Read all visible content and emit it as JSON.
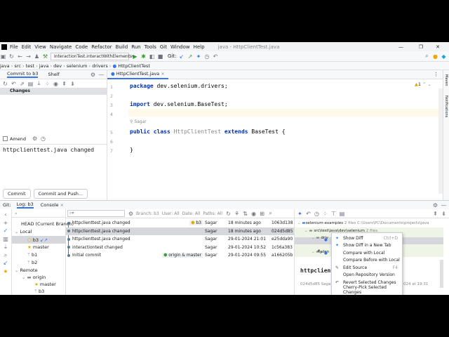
{
  "window": {
    "title": "java - HttpClientTest.java",
    "menu": [
      "File",
      "Edit",
      "View",
      "Navigate",
      "Code",
      "Refactor",
      "Build",
      "Run",
      "Tools",
      "Git",
      "Window",
      "Help"
    ]
  },
  "toolbar": {
    "run_config": "InteractionTest.interactWithElements",
    "git_label": "Git:"
  },
  "breadcrumb": [
    "java",
    "src",
    "test",
    "java",
    "dev",
    "selenium",
    "drivers",
    "HttpClientTest"
  ],
  "commit_panel": {
    "tabs": [
      "Commit to b3",
      "Shelf"
    ],
    "changes_header": "Changes",
    "amend_label": "Amend",
    "message": "httpclienttest.java changed",
    "commit_button": "Commit",
    "commit_push_button": "Commit and Push..."
  },
  "editor": {
    "tab": "HttpClientTest.java",
    "warnings": "1",
    "right_strip": [
      "Maven",
      "Notifications"
    ],
    "lines": [
      {
        "n": "1",
        "t": "package"
      },
      {
        "n": "2"
      },
      {
        "n": "3"
      },
      {
        "n": "4"
      },
      {
        "n": "5"
      },
      {
        "n": "6"
      },
      {
        "n": "7"
      }
    ],
    "code": {
      "l1_kw": "package",
      "l1_rest": " dev.selenium.drivers;",
      "l3_kw": "import",
      "l3_rest": " dev.selenium.BaseTest;",
      "author": "Sagar",
      "l5_kw1": "public class",
      "l5_name": " HttpClientTest ",
      "l5_kw2": "extends",
      "l5_rest": " BaseTest {",
      "l7": "}"
    }
  },
  "git": {
    "tabs": [
      "Git:",
      "Log: b3",
      "Console"
    ],
    "branches": {
      "head": "HEAD (Current Branch)",
      "local": "Local",
      "local_items": [
        "b3",
        "master",
        "b1",
        "b2"
      ],
      "remote": "Remote",
      "origin": "origin",
      "remote_items": [
        "master",
        "b3"
      ]
    },
    "filters": {
      "branch": "Branch: b3",
      "user": "User: All",
      "date": "Date: All",
      "paths": "Paths: All"
    },
    "commits": [
      {
        "msg": "httpclienttest.java changed",
        "tag": "b3",
        "author": "Sagar",
        "date": "18 minutes ago",
        "hash": "1063d138"
      },
      {
        "msg": "httpclienttest.java changed",
        "tag": "",
        "author": "Sagar",
        "date": "18 minutes ago",
        "hash": "024d5d85"
      },
      {
        "msg": "httpclienttest.java changed",
        "tag": "",
        "author": "Sagar",
        "date": "29-01-2024 21:01",
        "hash": "e25dda90"
      },
      {
        "msg": "interactiontest changed",
        "tag": "",
        "author": "Sagar",
        "date": "29-01-2024 10:52",
        "hash": "1c56a383"
      },
      {
        "msg": "Initial commit",
        "tag": "origin & master",
        "author": "Sagar",
        "date": "29-01-2024 09:55",
        "hash": "a166205b"
      }
    ],
    "details": {
      "root": "selenium-examples",
      "root_meta": "2 files  C:\\Users\\PC\\Documents\\projects\\java",
      "src": "src\\test\\java\\dev\\selenium",
      "src_meta": "2 files",
      "drivers": "driv",
      "elements": "elen",
      "commit_title": "httpclient",
      "commit_meta": "024d5d85 Sagar",
      "commit_date": "024 at 19:31"
    }
  },
  "context_menu": [
    {
      "label": "Show Diff",
      "shortcut": "Ctrl+D"
    },
    {
      "label": "Show Diff in a New Tab"
    },
    {
      "label": "Compare with Local"
    },
    {
      "label": "Compare Before with Local"
    },
    {
      "label": "Edit Source",
      "shortcut": "F4"
    },
    {
      "label": "Open Repository Version"
    },
    {
      "label": "Revert Selected Changes"
    },
    {
      "label": "Cherry-Pick Selected Changes"
    }
  ]
}
